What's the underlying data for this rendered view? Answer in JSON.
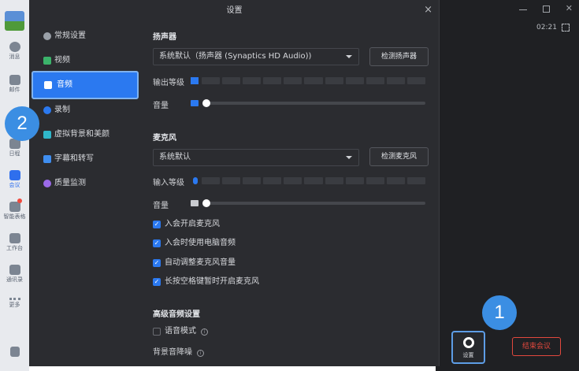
{
  "rail": {
    "items": [
      {
        "label": "消息",
        "icon": "chat-icon"
      },
      {
        "label": "邮件",
        "icon": "mail-icon"
      },
      {
        "label": "日程",
        "icon": "calendar-icon"
      },
      {
        "label": "会议",
        "icon": "meeting-icon"
      },
      {
        "label": "智能表格",
        "icon": "sheet-icon"
      },
      {
        "label": "工作台",
        "icon": "grid-icon"
      },
      {
        "label": "通讯录",
        "icon": "contacts-icon"
      },
      {
        "label": "更多",
        "icon": "more-icon"
      }
    ]
  },
  "dialog": {
    "title": "设置",
    "close": "×",
    "nav": [
      {
        "label": "常规设置",
        "icon": "gear-icon"
      },
      {
        "label": "视频",
        "icon": "video-icon"
      },
      {
        "label": "音频",
        "icon": "speaker-icon"
      },
      {
        "label": "录制",
        "icon": "record-icon"
      },
      {
        "label": "虚拟背景和美颜",
        "icon": "background-icon"
      },
      {
        "label": "字幕和转写",
        "icon": "caption-icon"
      },
      {
        "label": "质量监测",
        "icon": "monitor-icon"
      }
    ],
    "speaker": {
      "title": "扬声器",
      "device": "系统默认（扬声器 (Synaptics HD Audio))",
      "test_button": "检测扬声器",
      "output_level_label": "输出等级",
      "volume_label": "音量",
      "volume_level": 0
    },
    "mic": {
      "title": "麦克风",
      "device": "系统默认",
      "test_button": "检测麦克风",
      "input_level_label": "输入等级",
      "volume_label": "音量",
      "volume_level": 0
    },
    "options": [
      {
        "label": "入会开启麦克风",
        "checked": true
      },
      {
        "label": "入会时使用电脑音频",
        "checked": true
      },
      {
        "label": "自动调整麦克风音量",
        "checked": true
      },
      {
        "label": "长按空格键暂时开启麦克风",
        "checked": true
      }
    ],
    "advanced": {
      "title": "高级音频设置",
      "music_mode": "语音模式",
      "noise_label": "背景音降噪"
    }
  },
  "meeting": {
    "timer": "02:21",
    "settings_label": "设置",
    "end_label": "结束会议"
  },
  "steps": [
    "1",
    "2"
  ],
  "colors": {
    "accent": "#2b79f0",
    "badge": "#3b8ee3",
    "danger": "#e2483d"
  }
}
